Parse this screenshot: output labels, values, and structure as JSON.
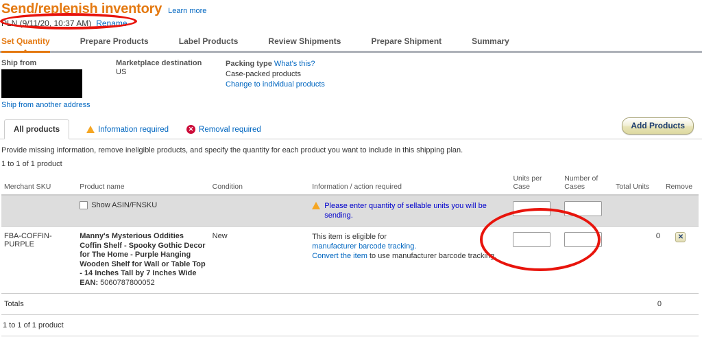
{
  "header": {
    "title": "Send/replenish inventory",
    "learn_more": "Learn more",
    "plan_name": "PLN (9/11/20, 10:37 AM)",
    "rename_link": "Rename"
  },
  "steps": [
    {
      "label": "Set Quantity",
      "active": true
    },
    {
      "label": "Prepare Products",
      "active": false
    },
    {
      "label": "Label Products",
      "active": false
    },
    {
      "label": "Review Shipments",
      "active": false
    },
    {
      "label": "Prepare Shipment",
      "active": false
    },
    {
      "label": "Summary",
      "active": false
    }
  ],
  "ship_info": {
    "ship_from_label": "Ship from",
    "ship_from_address": "",
    "ship_from_another": "Ship from another address",
    "destination_label": "Marketplace destination",
    "destination_value": "US",
    "packing_label": "Packing type",
    "packing_help": "What's this?",
    "packing_value": "Case-packed products",
    "packing_change": "Change to individual products"
  },
  "filters": {
    "tabs": [
      {
        "label": "All products",
        "icon": "none",
        "selected": true
      },
      {
        "label": "Information required",
        "icon": "warning-icon",
        "selected": false
      },
      {
        "label": "Removal required",
        "icon": "error-icon",
        "selected": false
      }
    ],
    "add_products": "Add Products"
  },
  "intro": "Provide missing information, remove ineligible products, and specify the quantity for each product you want to include in this shipping plan.",
  "count_top": "1 to 1 of 1 product",
  "count_bottom": "1 to 1 of 1 product",
  "table": {
    "headers": {
      "merchant_sku": "Merchant SKU",
      "product_name": "Product name",
      "condition": "Condition",
      "information": "Information / action required",
      "units_per_case": "Units per Case",
      "number_of_cases": "Number of Cases",
      "total_units": "Total Units",
      "remove": "Remove"
    },
    "message_row": {
      "show_asin_label": "Show ASIN/FNSKU",
      "show_asin_checked": false,
      "warning_text": "Please enter quantity of sellable units you will be sending.",
      "units_per_case_value": "",
      "number_of_cases_value": ""
    },
    "rows": [
      {
        "merchant_sku": "FBA-COFFIN-PURPLE",
        "product_name": "Manny's Mysterious Oddities Coffin Shelf - Spooky Gothic Decor for The Home - Purple Hanging Wooden Shelf for Wall or Table Top - 14 Inches Tall by 7 Inches Wide",
        "ean_label": "EAN:",
        "ean_value": "5060787800052",
        "condition": "New",
        "info_line1": "This item is eligible for",
        "info_link1": "manufacturer barcode tracking.",
        "info_link2": "Convert the item",
        "info_line2": " to use manufacturer barcode tracking.",
        "units_per_case_value": "",
        "number_of_cases_value": "",
        "total_units": "0",
        "remove_icon": "close-icon"
      }
    ]
  },
  "totals": {
    "label": "Totals",
    "value": "0"
  },
  "colors": {
    "accent_orange": "#e47911",
    "link_blue": "#0066c0",
    "warning_text_blue": "#0000cc",
    "annotation_red": "#e8140c",
    "warning_amber": "#f5a623",
    "error_red": "#cc0c39"
  }
}
